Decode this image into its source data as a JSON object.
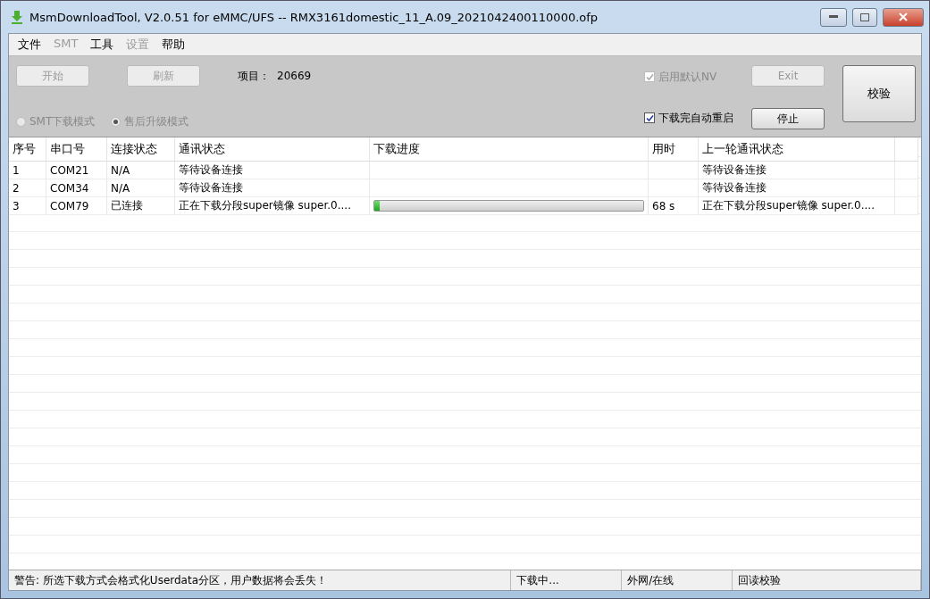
{
  "window": {
    "title": "MsmDownloadTool, V2.0.51 for eMMC/UFS -- RMX3161domestic_11_A.09_2021042400110000.ofp"
  },
  "menu": [
    {
      "label": "文件",
      "disabled": false
    },
    {
      "label": "SMT",
      "disabled": true
    },
    {
      "label": "工具",
      "disabled": false
    },
    {
      "label": "设置",
      "disabled": true
    },
    {
      "label": "帮助",
      "disabled": false
    }
  ],
  "toolbar": {
    "start_button": {
      "label": "开始",
      "disabled": true
    },
    "refresh_button": {
      "label": "刷新",
      "disabled": true
    },
    "project_label": "项目：",
    "project_value": "20669",
    "modes": [
      {
        "label": "SMT下载模式",
        "selected": false,
        "disabled": true
      },
      {
        "label": "售后升级模式",
        "selected": true,
        "disabled": true
      }
    ],
    "default_nv": {
      "label": "启用默认NV",
      "checked": true,
      "disabled": true
    },
    "auto_reboot": {
      "label": "下载完自动重启",
      "checked": true,
      "disabled": false
    },
    "exit_button": {
      "label": "Exit",
      "disabled": true
    },
    "stop_button": {
      "label": "停止",
      "disabled": false
    },
    "verify_button": {
      "label": "校验",
      "disabled": false
    }
  },
  "table": {
    "columns": [
      "序号",
      "串口号",
      "连接状态",
      "通讯状态",
      "下载进度",
      "用时",
      "上一轮通讯状态"
    ],
    "rows": [
      {
        "index": "1",
        "port": "COM21",
        "connection": "N/A",
        "status": "等待设备连接",
        "time": "",
        "last_status": "等待设备连接"
      },
      {
        "index": "2",
        "port": "COM34",
        "connection": "N/A",
        "status": "等待设备连接",
        "time": "",
        "last_status": "等待设备连接"
      },
      {
        "index": "3",
        "port": "COM79",
        "connection": "已连接",
        "status": "正在下载分段super镜像 super.0....",
        "level": 0.02,
        "time": "68 s",
        "last_status": "正在下载分段super镜像 super.0...."
      }
    ]
  },
  "status_bar": [
    "警告: 所选下载方式会格式化Userdata分区，用户数据将会丢失！",
    "下载中...",
    "外网/在线",
    "回读校验"
  ]
}
